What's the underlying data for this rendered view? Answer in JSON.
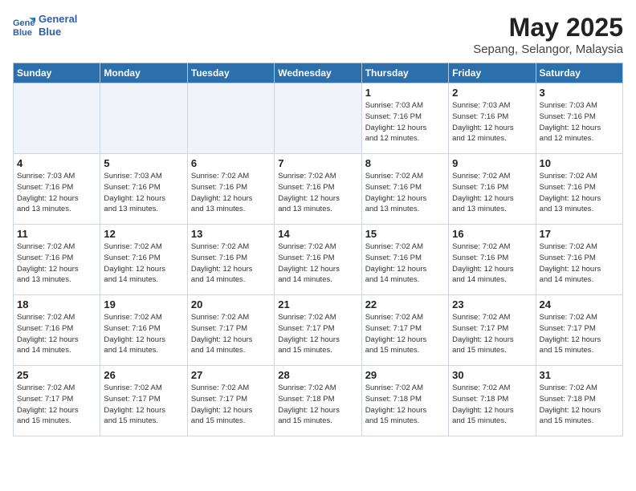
{
  "logo": {
    "line1": "General",
    "line2": "Blue"
  },
  "title": "May 2025",
  "location": "Sepang, Selangor, Malaysia",
  "days_of_week": [
    "Sunday",
    "Monday",
    "Tuesday",
    "Wednesday",
    "Thursday",
    "Friday",
    "Saturday"
  ],
  "weeks": [
    [
      {
        "day": "",
        "info": ""
      },
      {
        "day": "",
        "info": ""
      },
      {
        "day": "",
        "info": ""
      },
      {
        "day": "",
        "info": ""
      },
      {
        "day": "1",
        "info": "Sunrise: 7:03 AM\nSunset: 7:16 PM\nDaylight: 12 hours\nand 12 minutes."
      },
      {
        "day": "2",
        "info": "Sunrise: 7:03 AM\nSunset: 7:16 PM\nDaylight: 12 hours\nand 12 minutes."
      },
      {
        "day": "3",
        "info": "Sunrise: 7:03 AM\nSunset: 7:16 PM\nDaylight: 12 hours\nand 12 minutes."
      }
    ],
    [
      {
        "day": "4",
        "info": "Sunrise: 7:03 AM\nSunset: 7:16 PM\nDaylight: 12 hours\nand 13 minutes."
      },
      {
        "day": "5",
        "info": "Sunrise: 7:03 AM\nSunset: 7:16 PM\nDaylight: 12 hours\nand 13 minutes."
      },
      {
        "day": "6",
        "info": "Sunrise: 7:02 AM\nSunset: 7:16 PM\nDaylight: 12 hours\nand 13 minutes."
      },
      {
        "day": "7",
        "info": "Sunrise: 7:02 AM\nSunset: 7:16 PM\nDaylight: 12 hours\nand 13 minutes."
      },
      {
        "day": "8",
        "info": "Sunrise: 7:02 AM\nSunset: 7:16 PM\nDaylight: 12 hours\nand 13 minutes."
      },
      {
        "day": "9",
        "info": "Sunrise: 7:02 AM\nSunset: 7:16 PM\nDaylight: 12 hours\nand 13 minutes."
      },
      {
        "day": "10",
        "info": "Sunrise: 7:02 AM\nSunset: 7:16 PM\nDaylight: 12 hours\nand 13 minutes."
      }
    ],
    [
      {
        "day": "11",
        "info": "Sunrise: 7:02 AM\nSunset: 7:16 PM\nDaylight: 12 hours\nand 13 minutes."
      },
      {
        "day": "12",
        "info": "Sunrise: 7:02 AM\nSunset: 7:16 PM\nDaylight: 12 hours\nand 14 minutes."
      },
      {
        "day": "13",
        "info": "Sunrise: 7:02 AM\nSunset: 7:16 PM\nDaylight: 12 hours\nand 14 minutes."
      },
      {
        "day": "14",
        "info": "Sunrise: 7:02 AM\nSunset: 7:16 PM\nDaylight: 12 hours\nand 14 minutes."
      },
      {
        "day": "15",
        "info": "Sunrise: 7:02 AM\nSunset: 7:16 PM\nDaylight: 12 hours\nand 14 minutes."
      },
      {
        "day": "16",
        "info": "Sunrise: 7:02 AM\nSunset: 7:16 PM\nDaylight: 12 hours\nand 14 minutes."
      },
      {
        "day": "17",
        "info": "Sunrise: 7:02 AM\nSunset: 7:16 PM\nDaylight: 12 hours\nand 14 minutes."
      }
    ],
    [
      {
        "day": "18",
        "info": "Sunrise: 7:02 AM\nSunset: 7:16 PM\nDaylight: 12 hours\nand 14 minutes."
      },
      {
        "day": "19",
        "info": "Sunrise: 7:02 AM\nSunset: 7:16 PM\nDaylight: 12 hours\nand 14 minutes."
      },
      {
        "day": "20",
        "info": "Sunrise: 7:02 AM\nSunset: 7:17 PM\nDaylight: 12 hours\nand 14 minutes."
      },
      {
        "day": "21",
        "info": "Sunrise: 7:02 AM\nSunset: 7:17 PM\nDaylight: 12 hours\nand 15 minutes."
      },
      {
        "day": "22",
        "info": "Sunrise: 7:02 AM\nSunset: 7:17 PM\nDaylight: 12 hours\nand 15 minutes."
      },
      {
        "day": "23",
        "info": "Sunrise: 7:02 AM\nSunset: 7:17 PM\nDaylight: 12 hours\nand 15 minutes."
      },
      {
        "day": "24",
        "info": "Sunrise: 7:02 AM\nSunset: 7:17 PM\nDaylight: 12 hours\nand 15 minutes."
      }
    ],
    [
      {
        "day": "25",
        "info": "Sunrise: 7:02 AM\nSunset: 7:17 PM\nDaylight: 12 hours\nand 15 minutes."
      },
      {
        "day": "26",
        "info": "Sunrise: 7:02 AM\nSunset: 7:17 PM\nDaylight: 12 hours\nand 15 minutes."
      },
      {
        "day": "27",
        "info": "Sunrise: 7:02 AM\nSunset: 7:17 PM\nDaylight: 12 hours\nand 15 minutes."
      },
      {
        "day": "28",
        "info": "Sunrise: 7:02 AM\nSunset: 7:18 PM\nDaylight: 12 hours\nand 15 minutes."
      },
      {
        "day": "29",
        "info": "Sunrise: 7:02 AM\nSunset: 7:18 PM\nDaylight: 12 hours\nand 15 minutes."
      },
      {
        "day": "30",
        "info": "Sunrise: 7:02 AM\nSunset: 7:18 PM\nDaylight: 12 hours\nand 15 minutes."
      },
      {
        "day": "31",
        "info": "Sunrise: 7:02 AM\nSunset: 7:18 PM\nDaylight: 12 hours\nand 15 minutes."
      }
    ]
  ]
}
